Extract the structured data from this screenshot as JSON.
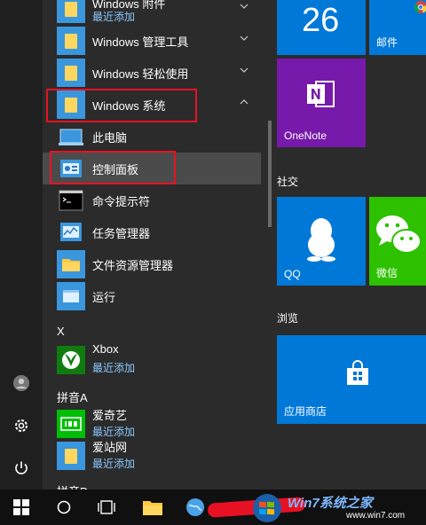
{
  "apps": {
    "win_accessories": {
      "label": "Windows 附件",
      "sub": "最近添加"
    },
    "win_admin": {
      "label": "Windows 管理工具"
    },
    "win_ease": {
      "label": "Windows 轻松使用"
    },
    "win_system": {
      "label": "Windows 系统"
    },
    "this_pc": {
      "label": "此电脑"
    },
    "control_panel": {
      "label": "控制面板"
    },
    "cmd": {
      "label": "命令提示符"
    },
    "task_manager": {
      "label": "任务管理器"
    },
    "explorer": {
      "label": "文件资源管理器"
    },
    "run": {
      "label": "运行"
    },
    "letter_x": "X",
    "xbox": {
      "label": "Xbox",
      "sub": "最近添加"
    },
    "letter_a": "拼音A",
    "iqiyi": {
      "label": "爱奇艺",
      "sub": "最近添加"
    },
    "aizhan": {
      "label": "爱站网",
      "sub": "最近添加"
    },
    "letter_d": "拼音D"
  },
  "tiles": {
    "calendar_day": "26",
    "mail": "邮件",
    "onenote": "OneNote",
    "social_group": "社交",
    "qq": "QQ",
    "wechat": "微信",
    "browse_group": "浏览",
    "store": "应用商店"
  },
  "watermark": {
    "line1": "Win7系统之家",
    "line2": "www.win7.com"
  },
  "colors": {
    "accent": "#0078d7",
    "onenote": "#7719aa",
    "wechat": "#2dc100",
    "highlight": "#e81123"
  }
}
